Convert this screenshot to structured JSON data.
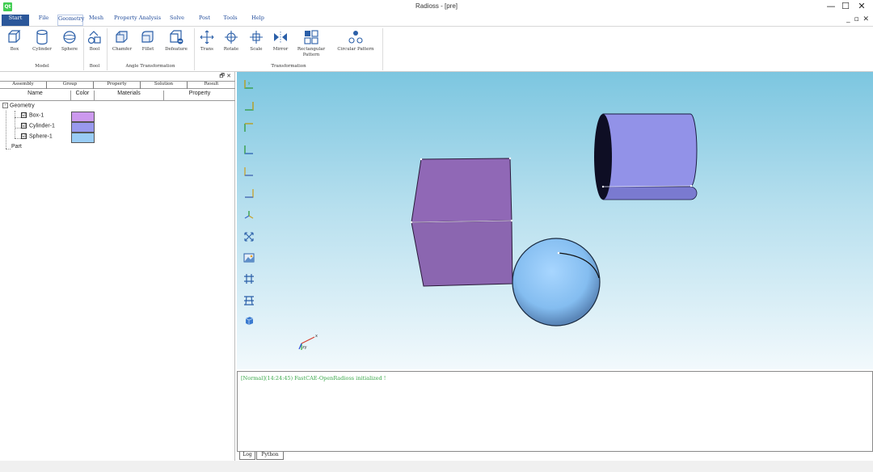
{
  "window": {
    "title": "Radioss - [pre]",
    "logo": "Qt",
    "minimize": "—",
    "maximize": "☐",
    "close": "✕"
  },
  "menu": {
    "items": [
      "Start",
      "File",
      "Geometry",
      "Mesh",
      "Property Analysis",
      "Solve",
      "Post",
      "Tools",
      "Help"
    ],
    "mdi": "_ ▫ ✕"
  },
  "ribbon": {
    "tools": [
      "Box",
      "Cylinder",
      "Sphere",
      "Bool",
      "Chamfer",
      "Fillet",
      "Defeature",
      "Trans",
      "Rotate",
      "Scale",
      "Mirror",
      "Rectangular Pattern",
      "Circular Pattern"
    ],
    "groups": [
      "Model",
      "Bool",
      "Angle Transformation",
      "Transformation"
    ]
  },
  "panel": {
    "ctrls": "🗗 ✕",
    "tabs": [
      "Assembly",
      "Group",
      "Property",
      "Solution",
      "Result"
    ],
    "columns": [
      "Name",
      "Color",
      "Materials",
      "Property"
    ],
    "tree": {
      "geometry_label": "Geometry",
      "items": [
        {
          "name": "Box-1",
          "checked": "☑",
          "color": "#cc99ee"
        },
        {
          "name": "Cylinder-1",
          "checked": "☑",
          "color": "#9999ee"
        },
        {
          "name": "Sphere-1",
          "checked": "☑",
          "color": "#99ccf5"
        }
      ],
      "part_label": "Part"
    }
  },
  "viewport": {
    "tools": [
      "view-front-icon",
      "view-back-icon",
      "view-top-icon",
      "view-bottom-icon",
      "view-left-icon",
      "view-right-icon",
      "view-iso-icon",
      "fit-view-icon",
      "screenshot-icon",
      "grid-icon",
      "mesh-grid-icon",
      "display-mode-icon"
    ],
    "colors": {
      "box": "#8e68b4",
      "cylinder": "#9090e6",
      "sphere": "#8ec2f0"
    }
  },
  "log": {
    "message": "[Normal](14:24:45) FastCAE-OpenRadioss initialized !",
    "tabs": [
      "Log",
      "Python"
    ]
  }
}
